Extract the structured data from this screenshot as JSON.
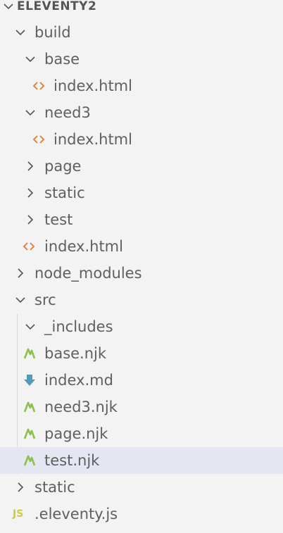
{
  "explorer": {
    "root_label": "ELEVENTY2"
  },
  "rows": [
    {
      "label": "build",
      "kind": "folder-open"
    },
    {
      "label": "base",
      "kind": "folder-open"
    },
    {
      "label": "index.html",
      "kind": "html"
    },
    {
      "label": "need3",
      "kind": "folder-open"
    },
    {
      "label": "index.html",
      "kind": "html"
    },
    {
      "label": "page",
      "kind": "folder-closed"
    },
    {
      "label": "static",
      "kind": "folder-closed"
    },
    {
      "label": "test",
      "kind": "folder-closed"
    },
    {
      "label": "index.html",
      "kind": "html"
    },
    {
      "label": "node_modules",
      "kind": "folder-closed"
    },
    {
      "label": "src",
      "kind": "folder-open"
    },
    {
      "label": "_includes",
      "kind": "folder-open"
    },
    {
      "label": "base.njk",
      "kind": "njk"
    },
    {
      "label": "index.md",
      "kind": "markdown"
    },
    {
      "label": "need3.njk",
      "kind": "njk"
    },
    {
      "label": "page.njk",
      "kind": "njk"
    },
    {
      "label": "test.njk",
      "kind": "njk",
      "selected": true
    },
    {
      "label": "static",
      "kind": "folder-closed"
    },
    {
      "label": ".eleventy.js",
      "kind": "js"
    }
  ],
  "icons": {
    "js_badge": "JS",
    "html": "html-code-icon",
    "njk": "nunjucks-icon",
    "markdown": "markdown-download-icon",
    "chevron_open": "chevron-down-icon",
    "chevron_closed": "chevron-right-icon"
  },
  "colors": {
    "background": "#f3f3f3",
    "selected_row": "#e4e6f1",
    "html_icon": "#e37933",
    "njk_icon": "#8dc149",
    "markdown_icon": "#519aba",
    "js_icon": "#cbcb41",
    "text": "#5f5f5f"
  }
}
